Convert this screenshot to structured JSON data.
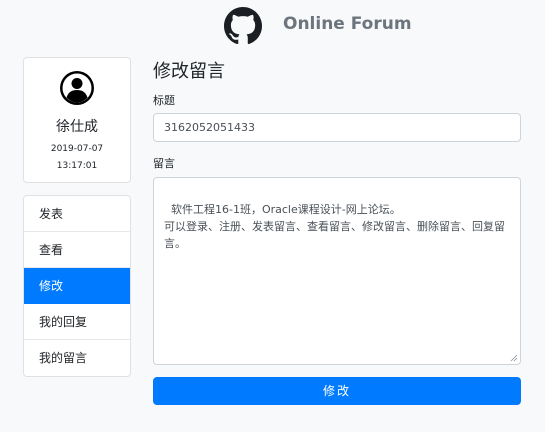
{
  "header": {
    "brand": "Online Forum",
    "logo_icon": "github-icon"
  },
  "profile": {
    "avatar_icon": "user-circle-icon",
    "name": "徐仕成",
    "date": "2019-07-07",
    "time": "13:17:01"
  },
  "menu": {
    "items": [
      {
        "label": "发表",
        "active": false
      },
      {
        "label": "查看",
        "active": false
      },
      {
        "label": "修改",
        "active": true
      },
      {
        "label": "我的回复",
        "active": false
      },
      {
        "label": "我的留言",
        "active": false
      }
    ]
  },
  "form": {
    "heading": "修改留言",
    "title_label": "标题",
    "title_value": "3162052051433",
    "message_label": "留言",
    "message_value": "软件工程16-1班，Oracle课程设计-网上论坛。\n可以登录、注册、发表留言、查看留言、修改留言、删除留言、回复留言。",
    "submit_label": "修改"
  },
  "colors": {
    "primary": "#007bff",
    "background": "#f8f9fa",
    "brand_text": "#6c757d"
  }
}
